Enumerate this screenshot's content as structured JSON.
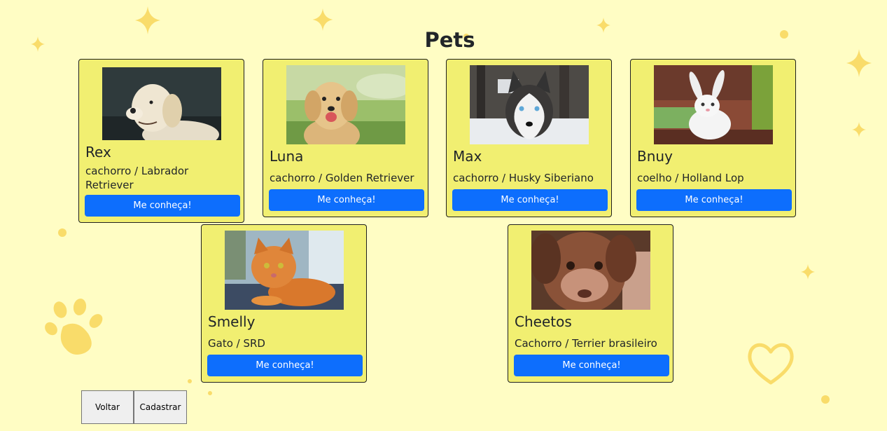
{
  "page": {
    "title": "Pets"
  },
  "pets": [
    {
      "name": "Rex",
      "info": "cachorro / Labrador Retriever",
      "button": "Me conheça!",
      "image": "labrador-photo"
    },
    {
      "name": "Luna",
      "info": "cachorro / Golden Retriever",
      "button": "Me conheça!",
      "image": "golden-retriever-photo"
    },
    {
      "name": "Max",
      "info": "cachorro / Husky Siberiano",
      "button": "Me conheça!",
      "image": "husky-photo"
    },
    {
      "name": "Bnuy",
      "info": "coelho / Holland Lop",
      "button": "Me conheça!",
      "image": "rabbit-photo"
    },
    {
      "name": "Smelly",
      "info": "Gato / SRD",
      "button": "Me conheça!",
      "image": "orange-cat-photo"
    },
    {
      "name": "Cheetos",
      "info": "Cachorro / Terrier brasileiro",
      "button": "Me conheça!",
      "image": "puppy-photo"
    }
  ],
  "footer": {
    "back_label": "Voltar",
    "register_label": "Cadastrar"
  },
  "colors": {
    "background": "#fffdc4",
    "card": "#f1ef71",
    "button": "#0d6efd",
    "decoration": "#f9dc6a"
  },
  "decorations": [
    "sparkle-icon",
    "paw-icon",
    "heart-icon"
  ]
}
